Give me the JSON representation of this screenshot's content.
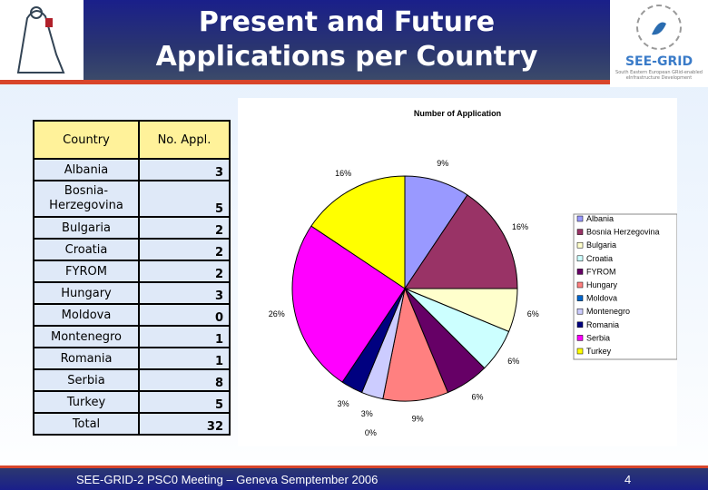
{
  "header": {
    "title_line1": "Present and Future",
    "title_line2": "Applications per Country",
    "logo_right_text": "SEE-GRID",
    "logo_right_sub": "South Eastern European GRid-enabled eInfrastructure Development"
  },
  "table": {
    "headers": [
      "Country",
      "No. Appl."
    ],
    "rows": [
      [
        "Albania",
        "3"
      ],
      [
        "Bosnia-Herzegovina",
        "5"
      ],
      [
        "Bulgaria",
        "2"
      ],
      [
        "Croatia",
        "2"
      ],
      [
        "FYROM",
        "2"
      ],
      [
        "Hungary",
        "3"
      ],
      [
        "Moldova",
        "0"
      ],
      [
        "Montenegro",
        "1"
      ],
      [
        "Romania",
        "1"
      ],
      [
        "Serbia",
        "8"
      ],
      [
        "Turkey",
        "5"
      ]
    ],
    "total": [
      "Total",
      "32"
    ]
  },
  "chart_data": {
    "type": "pie",
    "title": "Number of Application",
    "legend": "right",
    "categories": [
      "Albania",
      "Bosnia Herzegovina",
      "Bulgaria",
      "Croatia",
      "FYROM",
      "Hungary",
      "Moldova",
      "Montenegro",
      "Romania",
      "Serbia",
      "Turkey"
    ],
    "values": [
      3,
      5,
      2,
      2,
      2,
      3,
      0,
      1,
      1,
      8,
      5
    ],
    "labels": [
      "9%",
      "16%",
      "6%",
      "6%",
      "6%",
      "9%",
      "0%",
      "3%",
      "3%",
      "26%",
      "16%"
    ],
    "colors": [
      "#9999ff",
      "#993366",
      "#ffffcc",
      "#ccffff",
      "#660066",
      "#ff8080",
      "#0066cc",
      "#ccccff",
      "#000080",
      "#ff00ff",
      "#ffff00"
    ]
  },
  "footer": {
    "text": "SEE-GRID-2 PSC0 Meeting – Geneva Semptember 2006",
    "page": "4"
  }
}
